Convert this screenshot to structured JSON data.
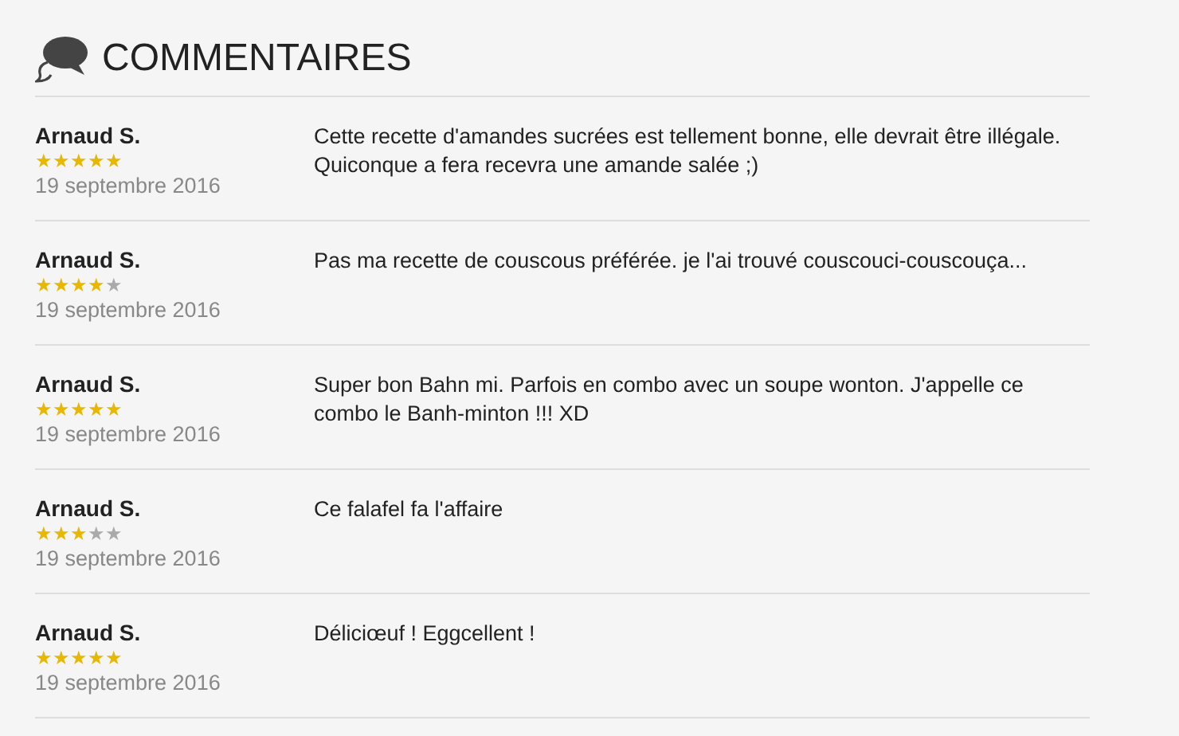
{
  "title": "COMMENTAIRES",
  "comments": [
    {
      "author": "Arnaud S.",
      "stars": 5,
      "date": "19 septembre 2016",
      "text": "Cette recette d'amandes sucrées est tellement bonne, elle devrait être illégale. Quiconque a fera recevra une amande salée ;)"
    },
    {
      "author": "Arnaud S.",
      "stars": 4,
      "date": "19 septembre 2016",
      "text": "Pas ma recette de couscous préférée. je l'ai trouvé couscouci-couscouça..."
    },
    {
      "author": "Arnaud S.",
      "stars": 5,
      "date": "19 septembre 2016",
      "text": "Super bon Bahn mi. Parfois en combo avec un soupe wonton. J'appelle ce combo le Banh-minton !!! XD"
    },
    {
      "author": "Arnaud S.",
      "stars": 3,
      "date": "19 septembre 2016",
      "text": "Ce falafel fa l'affaire"
    },
    {
      "author": "Arnaud S.",
      "stars": 5,
      "date": "19 septembre 2016",
      "text": "Déliciœuf ! Eggcellent !"
    }
  ]
}
